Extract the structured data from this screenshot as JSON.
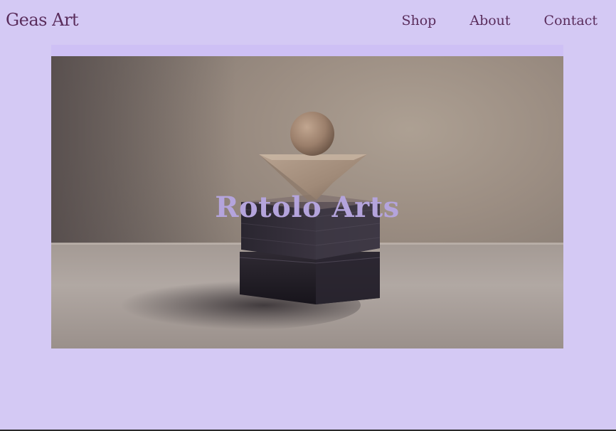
{
  "header": {
    "logo_text": "Geas Art",
    "nav": {
      "shop": "Shop",
      "about": "About",
      "contact": "Contact"
    }
  },
  "hero": {
    "title": "Rotolo Arts",
    "image_alt": "abstract sculpture: wooden sphere atop an inverted pyramid on dark stacked blocks"
  },
  "colors": {
    "background": "#d4c9f4",
    "nav_text": "#5a2d5c",
    "hero_title": "#b4a4dc"
  }
}
